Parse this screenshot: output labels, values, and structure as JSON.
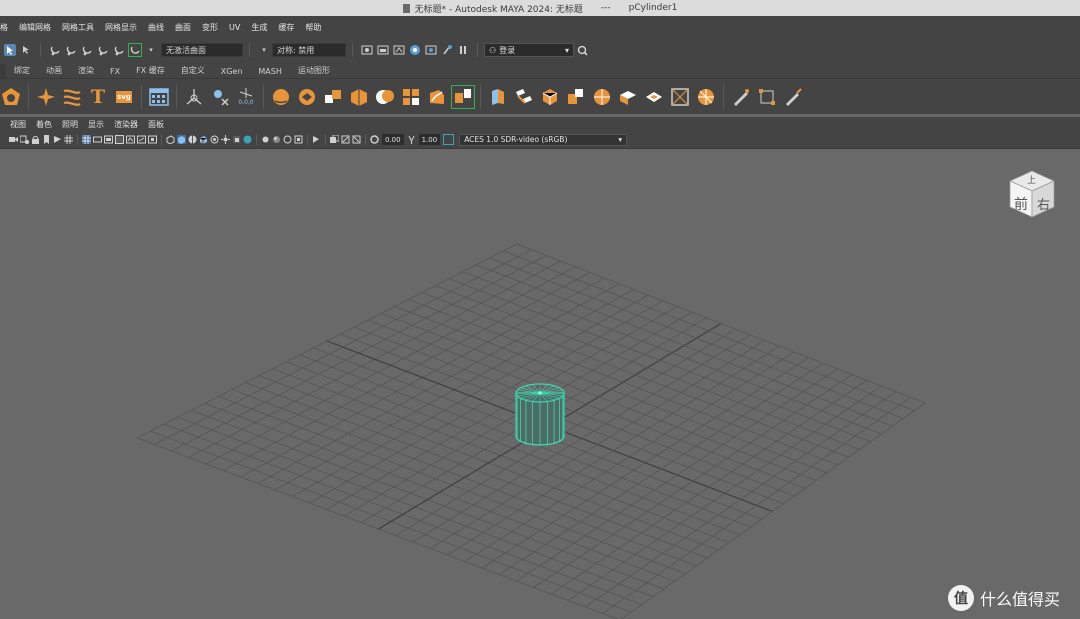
{
  "title_bar": {
    "title": "无标题* - Autodesk MAYA 2024: 无标题",
    "separator": "---",
    "object": "pCylinder1"
  },
  "main_menu": [
    "格",
    "编辑网格",
    "网格工具",
    "网格显示",
    "曲线",
    "曲面",
    "变形",
    "UV",
    "生成",
    "缓存",
    "帮助"
  ],
  "status_line": {
    "live_surface_field": "无激活曲面",
    "symmetry_field": "对称: 禁用",
    "login_label": "登录"
  },
  "shelf_tabs": [
    "绑定",
    "动画",
    "渲染",
    "FX",
    "FX 缓存",
    "自定义",
    "XGen",
    "MASH",
    "运动图形"
  ],
  "shelf": {
    "text_tool_glyph": "T",
    "svg_tool_label": "svg",
    "origin_label": "0,0,0"
  },
  "panel_menu": [
    "视图",
    "着色",
    "照明",
    "显示",
    "渲染器",
    "面板"
  ],
  "panel_toolbar": {
    "exposure_value": "0.00",
    "gamma_value": "1.00",
    "color_space": "ACES 1.0 SDR-video (sRGB)"
  },
  "viewcube": {
    "top_label": "上",
    "front_label": "前",
    "right_label": "右"
  },
  "watermark": {
    "logo_char": "值",
    "text": "什么值得买"
  },
  "colors": {
    "accent_orange": "#e8953a",
    "selection_teal": "#3ed6b0",
    "viewport_bg": "#696969",
    "grid_line": "#555555",
    "grid_axis": "#3f3f3f"
  }
}
